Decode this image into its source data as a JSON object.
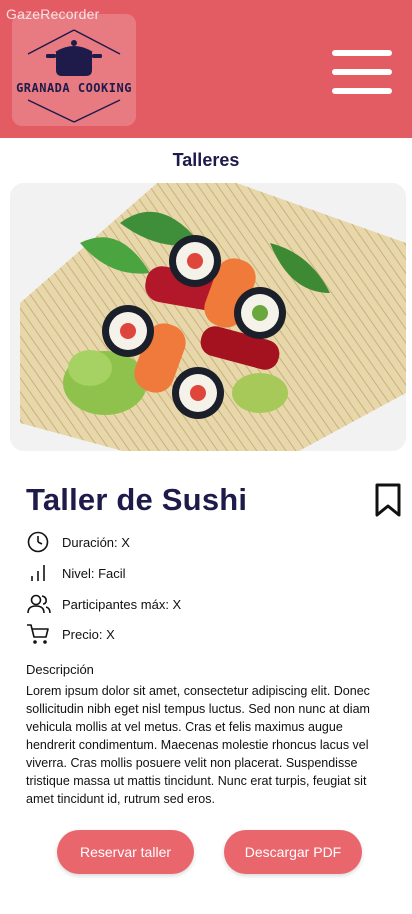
{
  "overlay": {
    "label": "GazeRecorder"
  },
  "header": {
    "brand": "GRANADA COOKING",
    "background_color": "#e35b63",
    "menu_icon": "hamburger-menu-icon"
  },
  "page": {
    "section_title": "Talleres",
    "hero_image_alt": "sushi-photo"
  },
  "workshop": {
    "title": "Taller de Sushi",
    "bookmark_icon": "bookmark-icon",
    "info": [
      {
        "icon": "clock-icon",
        "label": "Duración: X"
      },
      {
        "icon": "signal-bars-icon",
        "label": "Nivel: Facil"
      },
      {
        "icon": "users-icon",
        "label": "Participantes máx: X"
      },
      {
        "icon": "cart-icon",
        "label": "Precio: X"
      }
    ],
    "description_heading": "Descripción",
    "description": "Lorem ipsum dolor sit amet, consectetur adipiscing elit. Donec sollicitudin nibh eget nisl tempus luctus. Sed non nunc at diam vehicula mollis at vel metus. Cras et felis maximus augue hendrerit condimentum. Maecenas molestie rhoncus lacus vel viverra. Cras mollis posuere velit non placerat. Suspendisse tristique massa ut mattis tincidunt. Nunc erat turpis, feugiat sit amet tincidunt id, rutrum sed eros."
  },
  "actions": {
    "reserve_label": "Reservar taller",
    "pdf_label": "Descargar PDF",
    "button_color": "#e9666d"
  }
}
